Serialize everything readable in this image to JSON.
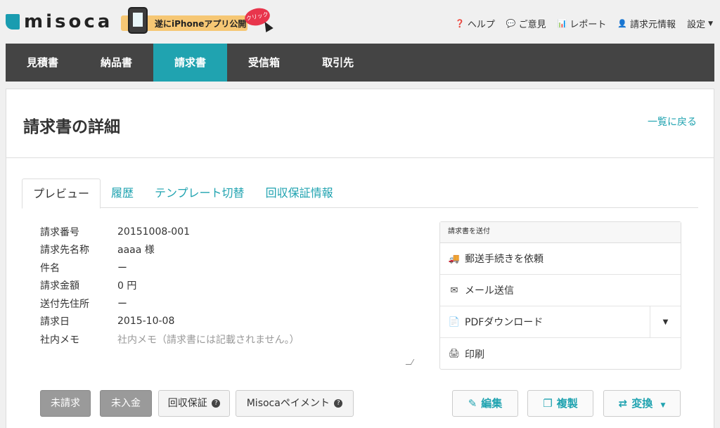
{
  "brand": {
    "name": "misoca",
    "promo_text": "遂にiPhoneアプリ公開",
    "promo_badge": "クリック"
  },
  "topnav": {
    "help": "ヘルプ",
    "feedback": "ご意見",
    "report": "レポート",
    "billing_info": "請求元情報",
    "settings": "設定"
  },
  "mainnav": {
    "items": [
      "見積書",
      "納品書",
      "請求書",
      "受信箱",
      "取引先"
    ],
    "active": "請求書"
  },
  "page": {
    "title": "請求書の詳細",
    "back_link": "一覧に戻る"
  },
  "tabs": [
    "プレビュー",
    "履歴",
    "テンプレート切替",
    "回収保証情報"
  ],
  "details": [
    {
      "label": "請求番号",
      "value": "20151008-001"
    },
    {
      "label": "請求先名称",
      "value": "aaaa 様"
    },
    {
      "label": "件名",
      "value": "ー"
    },
    {
      "label": "請求金額",
      "value": "0 円"
    },
    {
      "label": "送付先住所",
      "value": "ー"
    },
    {
      "label": "請求日",
      "value": "2015-10-08"
    },
    {
      "label": "社内メモ",
      "value": "",
      "placeholder": "社内メモ（請求書には記載されません。）"
    }
  ],
  "send": {
    "heading": "請求書を送付",
    "postal": "郵送手続きを依頼",
    "email": "メール送信",
    "pdf": "PDFダウンロード",
    "print": "印刷"
  },
  "status_buttons": {
    "unbilled": "未請求",
    "unpaid": "未入金",
    "guarantee": "回収保証",
    "misoca_payment": "Misocaペイメント"
  },
  "actions": {
    "edit": "編集",
    "duplicate": "複製",
    "convert": "変換"
  },
  "colors": {
    "accent": "#20a3b0",
    "nav_bg": "#444444"
  }
}
